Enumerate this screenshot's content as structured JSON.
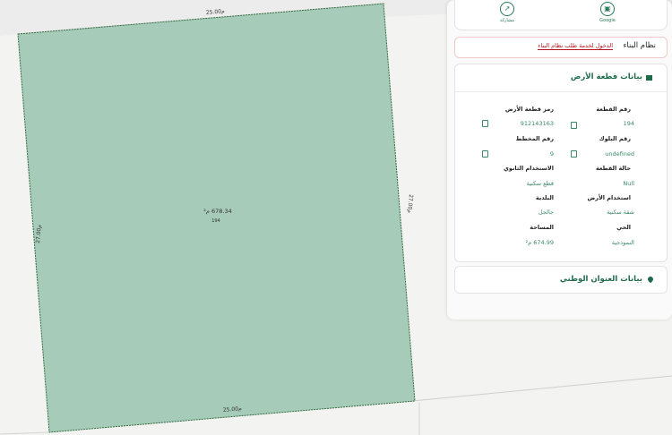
{
  "map": {
    "parcel_area_label": "678.34 م²",
    "parcel_number_label": "194",
    "dim_top": "25.00م",
    "dim_bottom": "25.00م",
    "dim_left": "27.00م",
    "dim_right": "27.00م",
    "parcel_fill": "#a6cbb9",
    "parcel_stroke": "#2f6b3e"
  },
  "top_actions": {
    "google_label": "Google",
    "share_label": "مشاركة"
  },
  "building": {
    "title": "نظام البناء",
    "link": "الدخول لخدمة طلب نظام البناء"
  },
  "land": {
    "title": "بيانات قطعة الأرض",
    "fields": {
      "parcel_no_label": "رقم القطعة",
      "parcel_no": "194",
      "parcel_code_label": "رمز قطعة الأرض",
      "parcel_code": "912143163",
      "block_label": "رقم البلوك",
      "block": "undefined",
      "plan_label": "رقم المخطط",
      "plan": "9",
      "status_label": "حالة القطعة",
      "status": "Null",
      "secondary_use_label": "الاستخدام الثانوي",
      "secondary_use": "قطع سكنية",
      "land_use_label": "استخدام الأرض",
      "land_use": "شقة سكنية",
      "municipality_label": "البلدية",
      "municipality": "جالجل",
      "district_label": "الحي",
      "district": "النموذجية",
      "area_label": "المساحة",
      "area": "674.99 م²"
    }
  },
  "address": {
    "title": "بيانات العنوان الوطني"
  },
  "colors": {
    "accent": "#1e6b4a",
    "danger": "#b5131f"
  }
}
